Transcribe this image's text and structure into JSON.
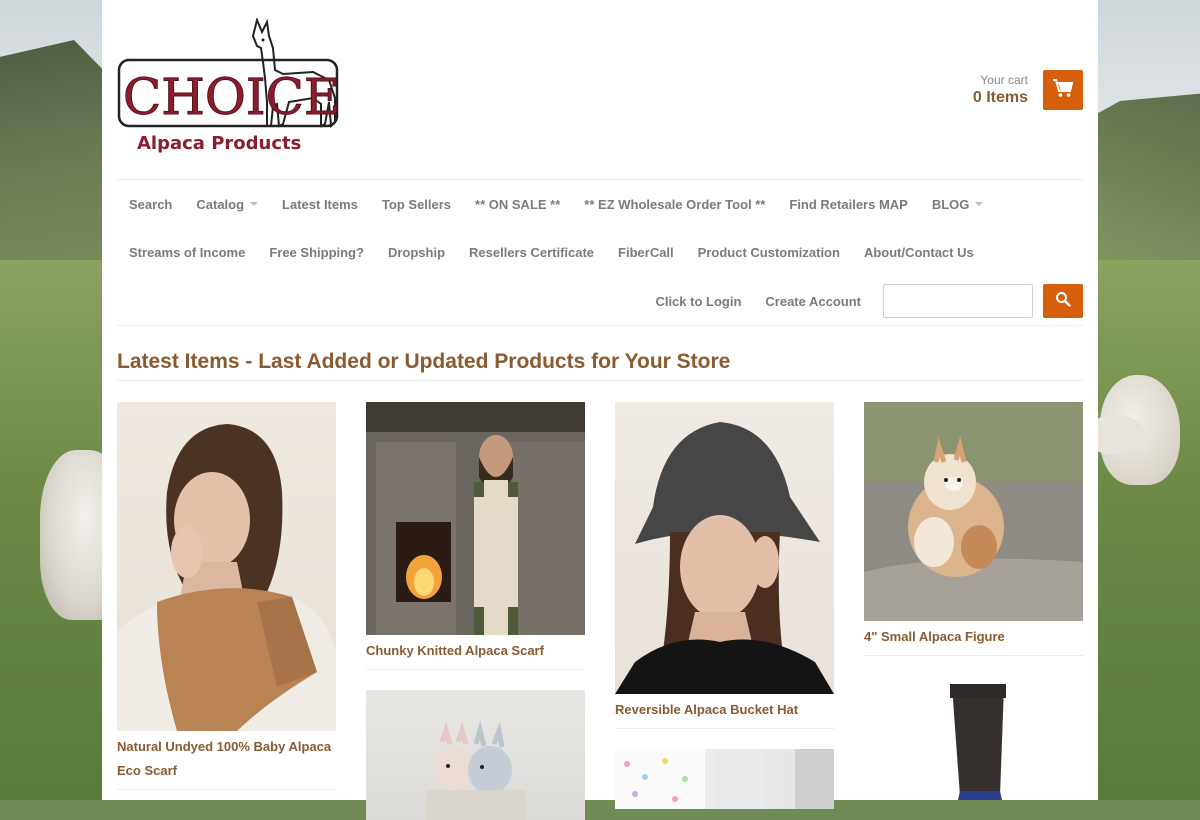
{
  "brand": {
    "logo_word": "CHOICE",
    "logo_sub": "Alpaca Products"
  },
  "cart": {
    "label": "Your cart",
    "count": "0 Items",
    "icon": "cart-icon"
  },
  "nav": {
    "row1": [
      "Search",
      "Catalog",
      "Latest Items",
      "Top Sellers",
      "** ON SALE **",
      "** EZ Wholesale Order Tool **",
      "Find Retailers MAP",
      "BLOG"
    ],
    "row2": [
      "Streams of Income",
      "Free Shipping?",
      "Dropship",
      "Resellers Certificate",
      "FiberCall",
      "Product Customization",
      "About/Contact Us"
    ],
    "login": "Click to Login",
    "create_account": "Create Account",
    "search_placeholder": "",
    "search_icon": "search-icon"
  },
  "page": {
    "title": "Latest Items - Last Added or Updated Products for Your Store"
  },
  "products": [
    {
      "name": "Natural Undyed 100% Baby Alpaca Eco Scarf"
    },
    {
      "name": "Chunky Knitted Alpaca Scarf"
    },
    {
      "name": "Reversible Alpaca Bucket Hat"
    },
    {
      "name": "4\" Small Alpaca Figure"
    }
  ],
  "colors": {
    "accent": "#d55f0a",
    "title_brown": "#8a5a30",
    "nav_gray": "#7b7b7b"
  }
}
